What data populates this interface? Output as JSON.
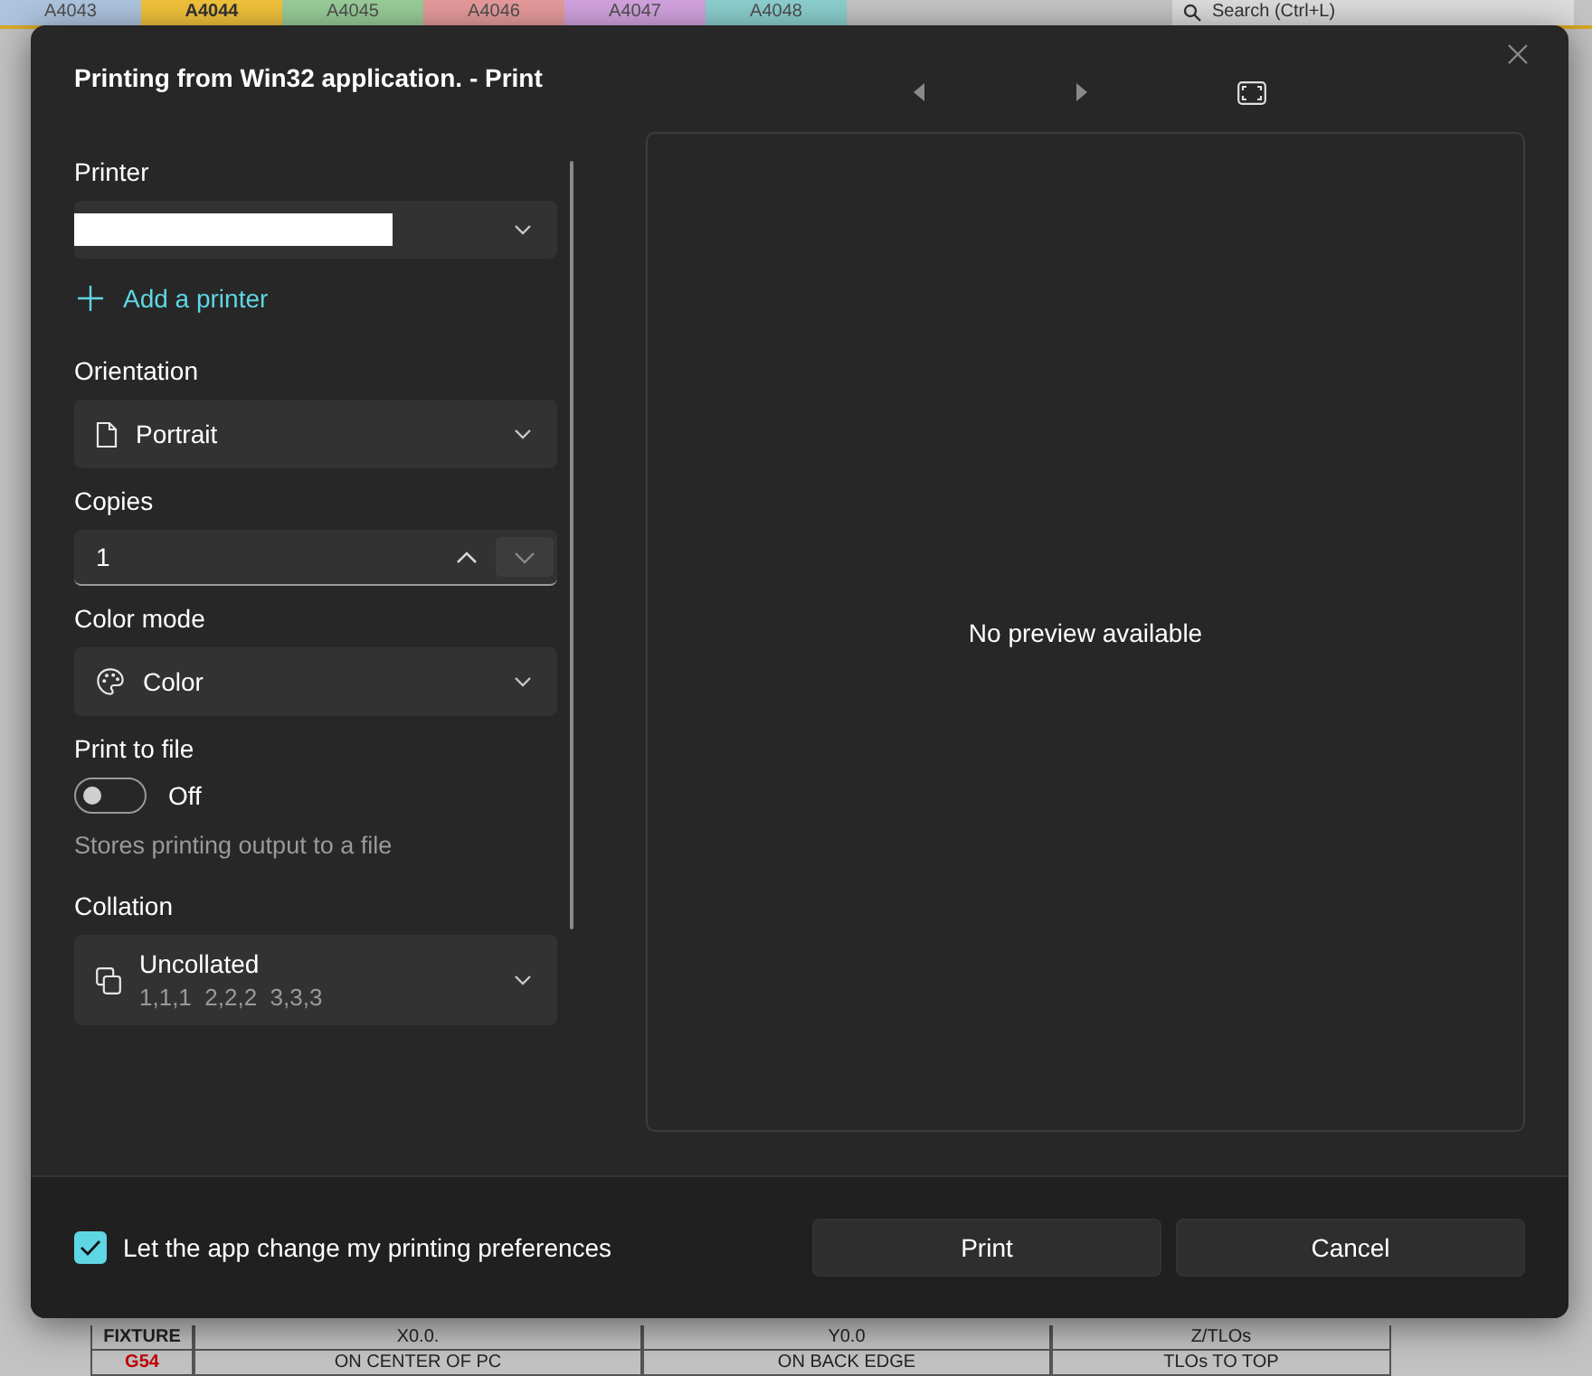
{
  "background_app": {
    "sheet_tabs": [
      {
        "label": "A4043",
        "selected": false,
        "color": "#a9c6e6"
      },
      {
        "label": "A4044",
        "selected": true,
        "color": "#f2c23c"
      },
      {
        "label": "A4045",
        "selected": false,
        "color": "#8fd08f"
      },
      {
        "label": "A4046",
        "selected": false,
        "color": "#ef9191"
      },
      {
        "label": "A4047",
        "selected": false,
        "color": "#d69be6"
      },
      {
        "label": "A4048",
        "selected": false,
        "color": "#7fd2d2"
      }
    ],
    "search": {
      "placeholder": "Search (Ctrl+L)"
    },
    "table_rows": [
      [
        "FIXTURE",
        "X0.0.",
        "Y0.0",
        "Z/TLOs"
      ],
      [
        "G54",
        "ON CENTER OF PC",
        "ON BACK EDGE",
        "TLOs TO TOP"
      ]
    ]
  },
  "dialog": {
    "title": "Printing from Win32 application. - Print",
    "settings": [
      {
        "kind": "printer",
        "label": "Printer"
      },
      {
        "kind": "link",
        "text": "Add a printer"
      },
      {
        "kind": "orientation",
        "label": "Orientation",
        "value": "Portrait"
      },
      {
        "kind": "copies",
        "label": "Copies",
        "value": "1"
      },
      {
        "kind": "colormode",
        "label": "Color mode",
        "value": "Color"
      },
      {
        "kind": "toggle",
        "label": "Print to file",
        "on": false,
        "state": "Off",
        "description": "Stores printing output to a file"
      },
      {
        "kind": "collation",
        "label": "Collation",
        "value": "Uncollated",
        "detail": "1,1,1  2,2,2  3,3,3"
      }
    ],
    "preview": {
      "message": "No preview available"
    },
    "preferences": {
      "label": "Let the app change my printing preferences",
      "checked": true
    },
    "buttons": [
      "Print",
      "Cancel"
    ]
  }
}
